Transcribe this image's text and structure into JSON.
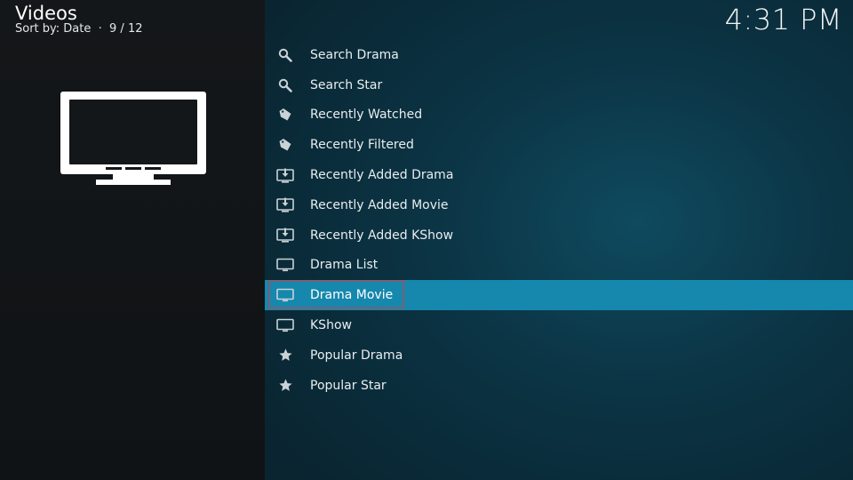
{
  "header": {
    "title": "Videos",
    "subtitle": "Sort by: Date  ·  9 / 12"
  },
  "clock": "4:31 PM",
  "thumbnail": {
    "icon": "tv-icon"
  },
  "menu": {
    "focused_index": 8,
    "items": [
      {
        "label": "Search Drama",
        "icon": "search-icon"
      },
      {
        "label": "Search Star",
        "icon": "search-icon"
      },
      {
        "label": "Recently Watched",
        "icon": "tag-icon"
      },
      {
        "label": "Recently Filtered",
        "icon": "tag-icon"
      },
      {
        "label": "Recently Added Drama",
        "icon": "download-tray-icon"
      },
      {
        "label": "Recently Added Movie",
        "icon": "download-tray-icon"
      },
      {
        "label": "Recently Added KShow",
        "icon": "download-tray-icon"
      },
      {
        "label": "Drama List",
        "icon": "monitor-icon"
      },
      {
        "label": "Drama Movie",
        "icon": "monitor-icon"
      },
      {
        "label": "KShow",
        "icon": "monitor-icon"
      },
      {
        "label": "Popular Drama",
        "icon": "star-icon"
      },
      {
        "label": "Popular Star",
        "icon": "star-icon"
      }
    ]
  },
  "colors": {
    "focus_bar": "#1687ad",
    "focus_outline": "#e0383d",
    "icon": "#c9d2d6"
  }
}
